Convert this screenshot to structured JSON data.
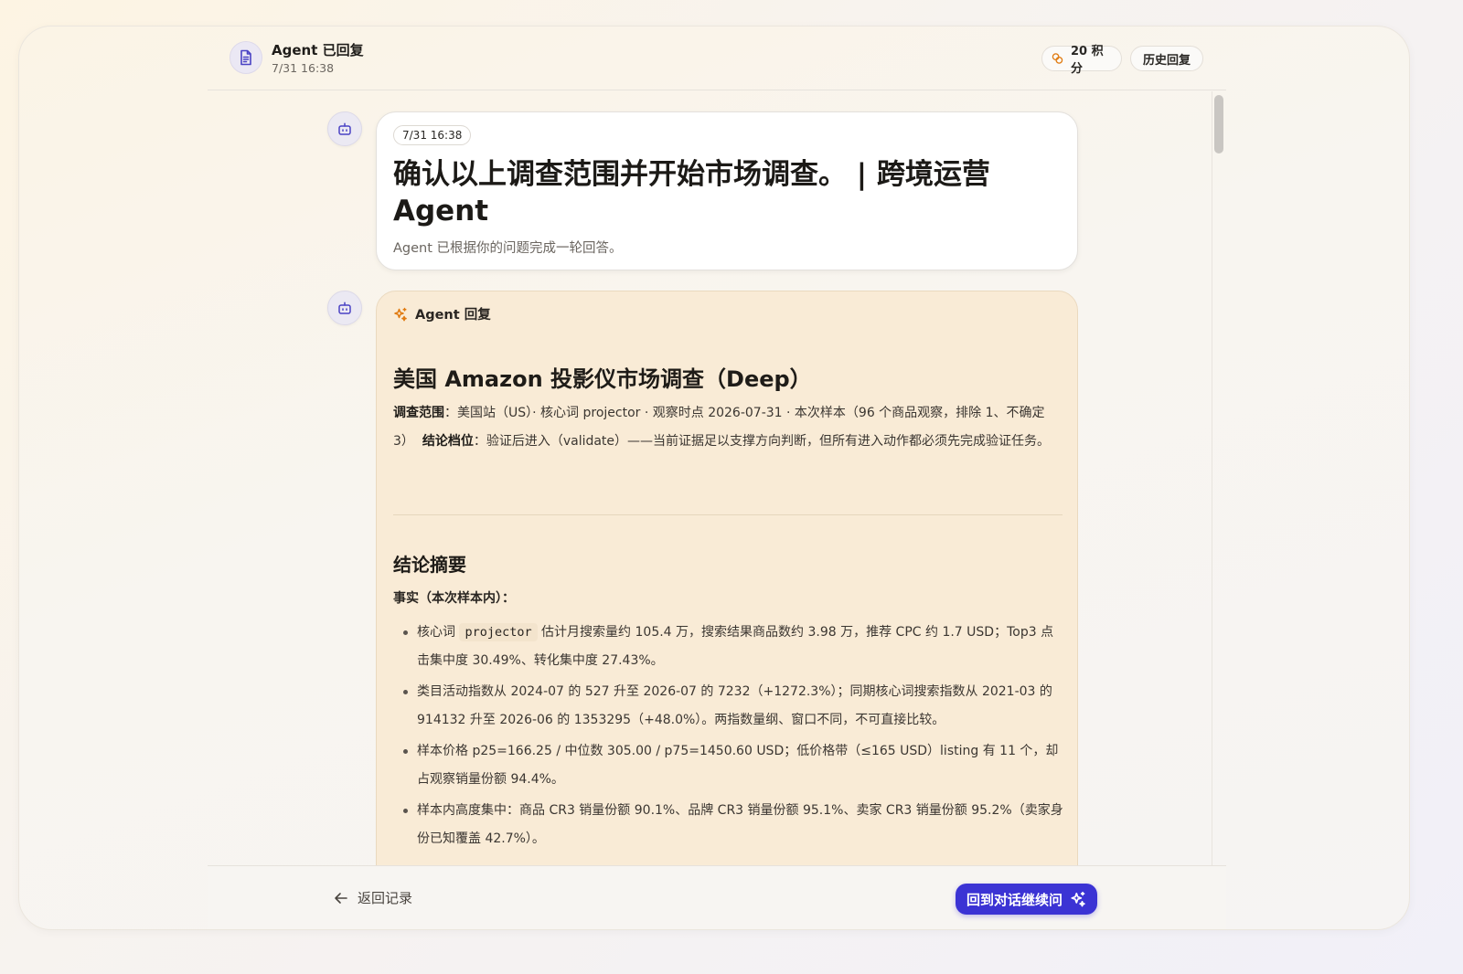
{
  "header": {
    "title": "Agent 已回复",
    "time": "7/31 16:38",
    "points": "20 积分",
    "history": "历史回复"
  },
  "prompt_card": {
    "timestamp": "7/31 16:38",
    "title": "确认以上调查范围并开始市场调查。 | 跨境运营 Agent",
    "subtitle": "Agent 已根据你的问题完成一轮回答。"
  },
  "reply_card": {
    "label": "Agent 回复",
    "heading": "美国 Amazon 投影仪市场调查（Deep）",
    "scope_label": "调查范围",
    "scope_text": "：美国站（US）· 核心词 projector · 观察时点 2026-07-31 · 本次样本（96 个商品观察，排除 1、不确定 3）",
    "conclusion_label": "结论档位",
    "conclusion_text": "：验证后进入（validate）——当前证据足以支撑方向判断，但所有进入动作都必须先完成验证任务。",
    "summary_heading": "结论摘要",
    "facts_label": "事实（本次样本内）：",
    "bullet1_pre": "核心词 ",
    "bullet1_code": "projector",
    "bullet1_post": " 估计月搜索量约 105.4 万，搜索结果商品数约 3.98 万，推荐 CPC 约 1.7 USD；Top3 点击集中度 30.49%、转化集中度 27.43%。",
    "bullet2": "类目活动指数从 2024-07 的 527 升至 2026-07 的 7232（+1272.3%）；同期核心词搜索指数从 2021-03 的 914132 升至 2026-06 的 1353295（+48.0%）。两指数量纲、窗口不同，不可直接比较。",
    "bullet3": "样本价格 p25=166.25 / 中位数 305.00 / p75=1450.60 USD；低价格带（≤165 USD）listing 有 11 个，却占观察销量份额 94.4%。",
    "bullet4": "样本内高度集中：商品 CR3 销量份额 90.1%、品牌 CR3 销量份额 95.1%、卖家 CR3 销量份额 95.2%（卖家身份已知覆盖 42.7%）。"
  },
  "footer": {
    "back": "返回记录",
    "continue": "回到对话继续问"
  },
  "colors": {
    "accent": "#3b33d4",
    "reply_bg": "#f9ebd6",
    "sparkle": "#e07a10"
  },
  "icons": [
    "document-icon",
    "coins-icon",
    "robot-icon",
    "sparkle-icon",
    "arrow-left-icon"
  ]
}
